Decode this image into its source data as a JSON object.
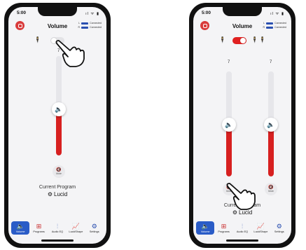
{
  "status_time": "5:00",
  "status_icons": "ıl ᯤ ▮",
  "title": "Volume",
  "connection": [
    {
      "side": "L",
      "status": "Connected"
    },
    {
      "side": "R",
      "status": "Connected"
    }
  ],
  "left_phone": {
    "level": "7",
    "level_fraction": 0.52,
    "mute_label": "Mute"
  },
  "right_phone": {
    "left_level": "7",
    "right_level": "7",
    "left_fraction": 0.55,
    "right_fraction": 0.55,
    "mute_label": "Mute"
  },
  "program": {
    "label": "Current Program",
    "name": "Lucid"
  },
  "tabs": [
    {
      "label": "Volume",
      "icon": "speaker-icon"
    },
    {
      "label": "Programs",
      "icon": "programs-icon"
    },
    {
      "label": "Audio EQ",
      "icon": "equalizer-icon"
    },
    {
      "label": "LucidShape",
      "icon": "chart-icon"
    },
    {
      "label": "Settings",
      "icon": "gear-icon"
    }
  ],
  "colors": {
    "accent": "#d72020",
    "tab_active": "#2a5cc7"
  }
}
